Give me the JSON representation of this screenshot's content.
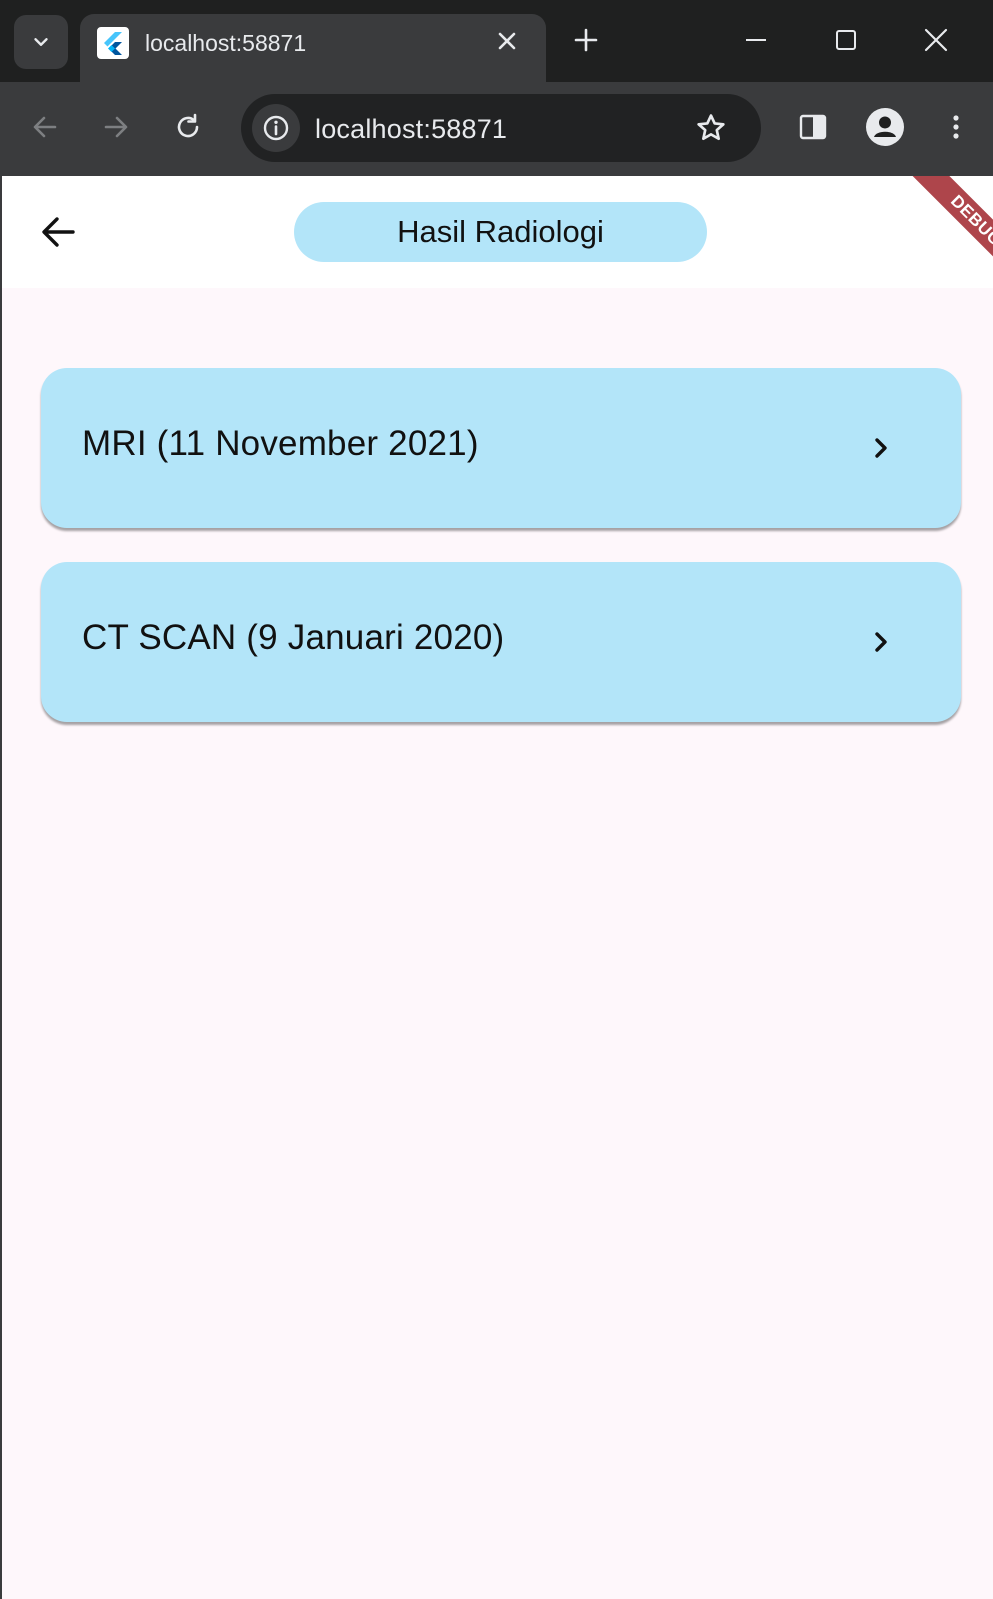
{
  "browser": {
    "tab_title": "localhost:58871",
    "url": "localhost:58871"
  },
  "app": {
    "page_title": "Hasil Radiologi",
    "debug_banner": "DEBUG",
    "results": [
      {
        "label": "MRI (11 November 2021)"
      },
      {
        "label": "CT SCAN (9 Januari 2020)"
      }
    ]
  },
  "colors": {
    "card_background": "#b3e5f9",
    "page_background": "#fef7fb",
    "debug_banner": "#a0252c"
  }
}
